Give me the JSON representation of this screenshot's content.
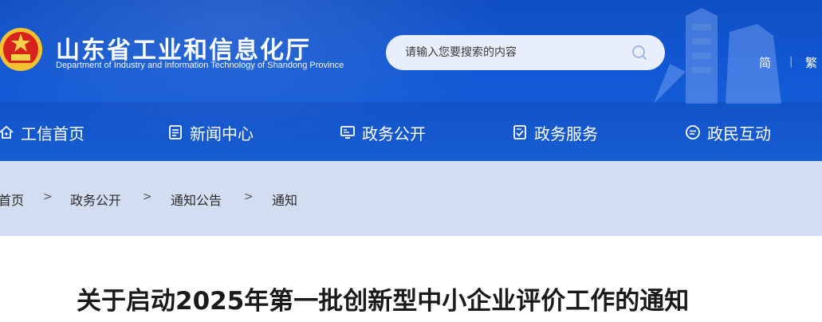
{
  "header": {
    "site_name": "山东省工业和信息化厅",
    "site_subtitle": "Department of Industry and Information Technology of Shandong Province",
    "search": {
      "placeholder": "请输入您要搜索的内容"
    },
    "lang": {
      "simplified": "简",
      "separator": "|",
      "traditional": "繁"
    }
  },
  "nav": {
    "items": [
      {
        "label": "工信首页",
        "icon": "home-icon"
      },
      {
        "label": "新闻中心",
        "icon": "document-icon"
      },
      {
        "label": "政务公开",
        "icon": "monitor-icon"
      },
      {
        "label": "政务服务",
        "icon": "service-icon"
      },
      {
        "label": "政民互动",
        "icon": "chat-icon"
      }
    ]
  },
  "breadcrumb": {
    "items": [
      "首页",
      "政务公开",
      "通知公告",
      "通知"
    ],
    "separator": ">"
  },
  "article": {
    "title": "关于启动2025年第一批创新型中小企业评价工作的通知"
  },
  "colors": {
    "header_blue": "#1258d4",
    "breadcrumb_bg": "#d3ddf1",
    "search_bg": "#e8eefc"
  }
}
